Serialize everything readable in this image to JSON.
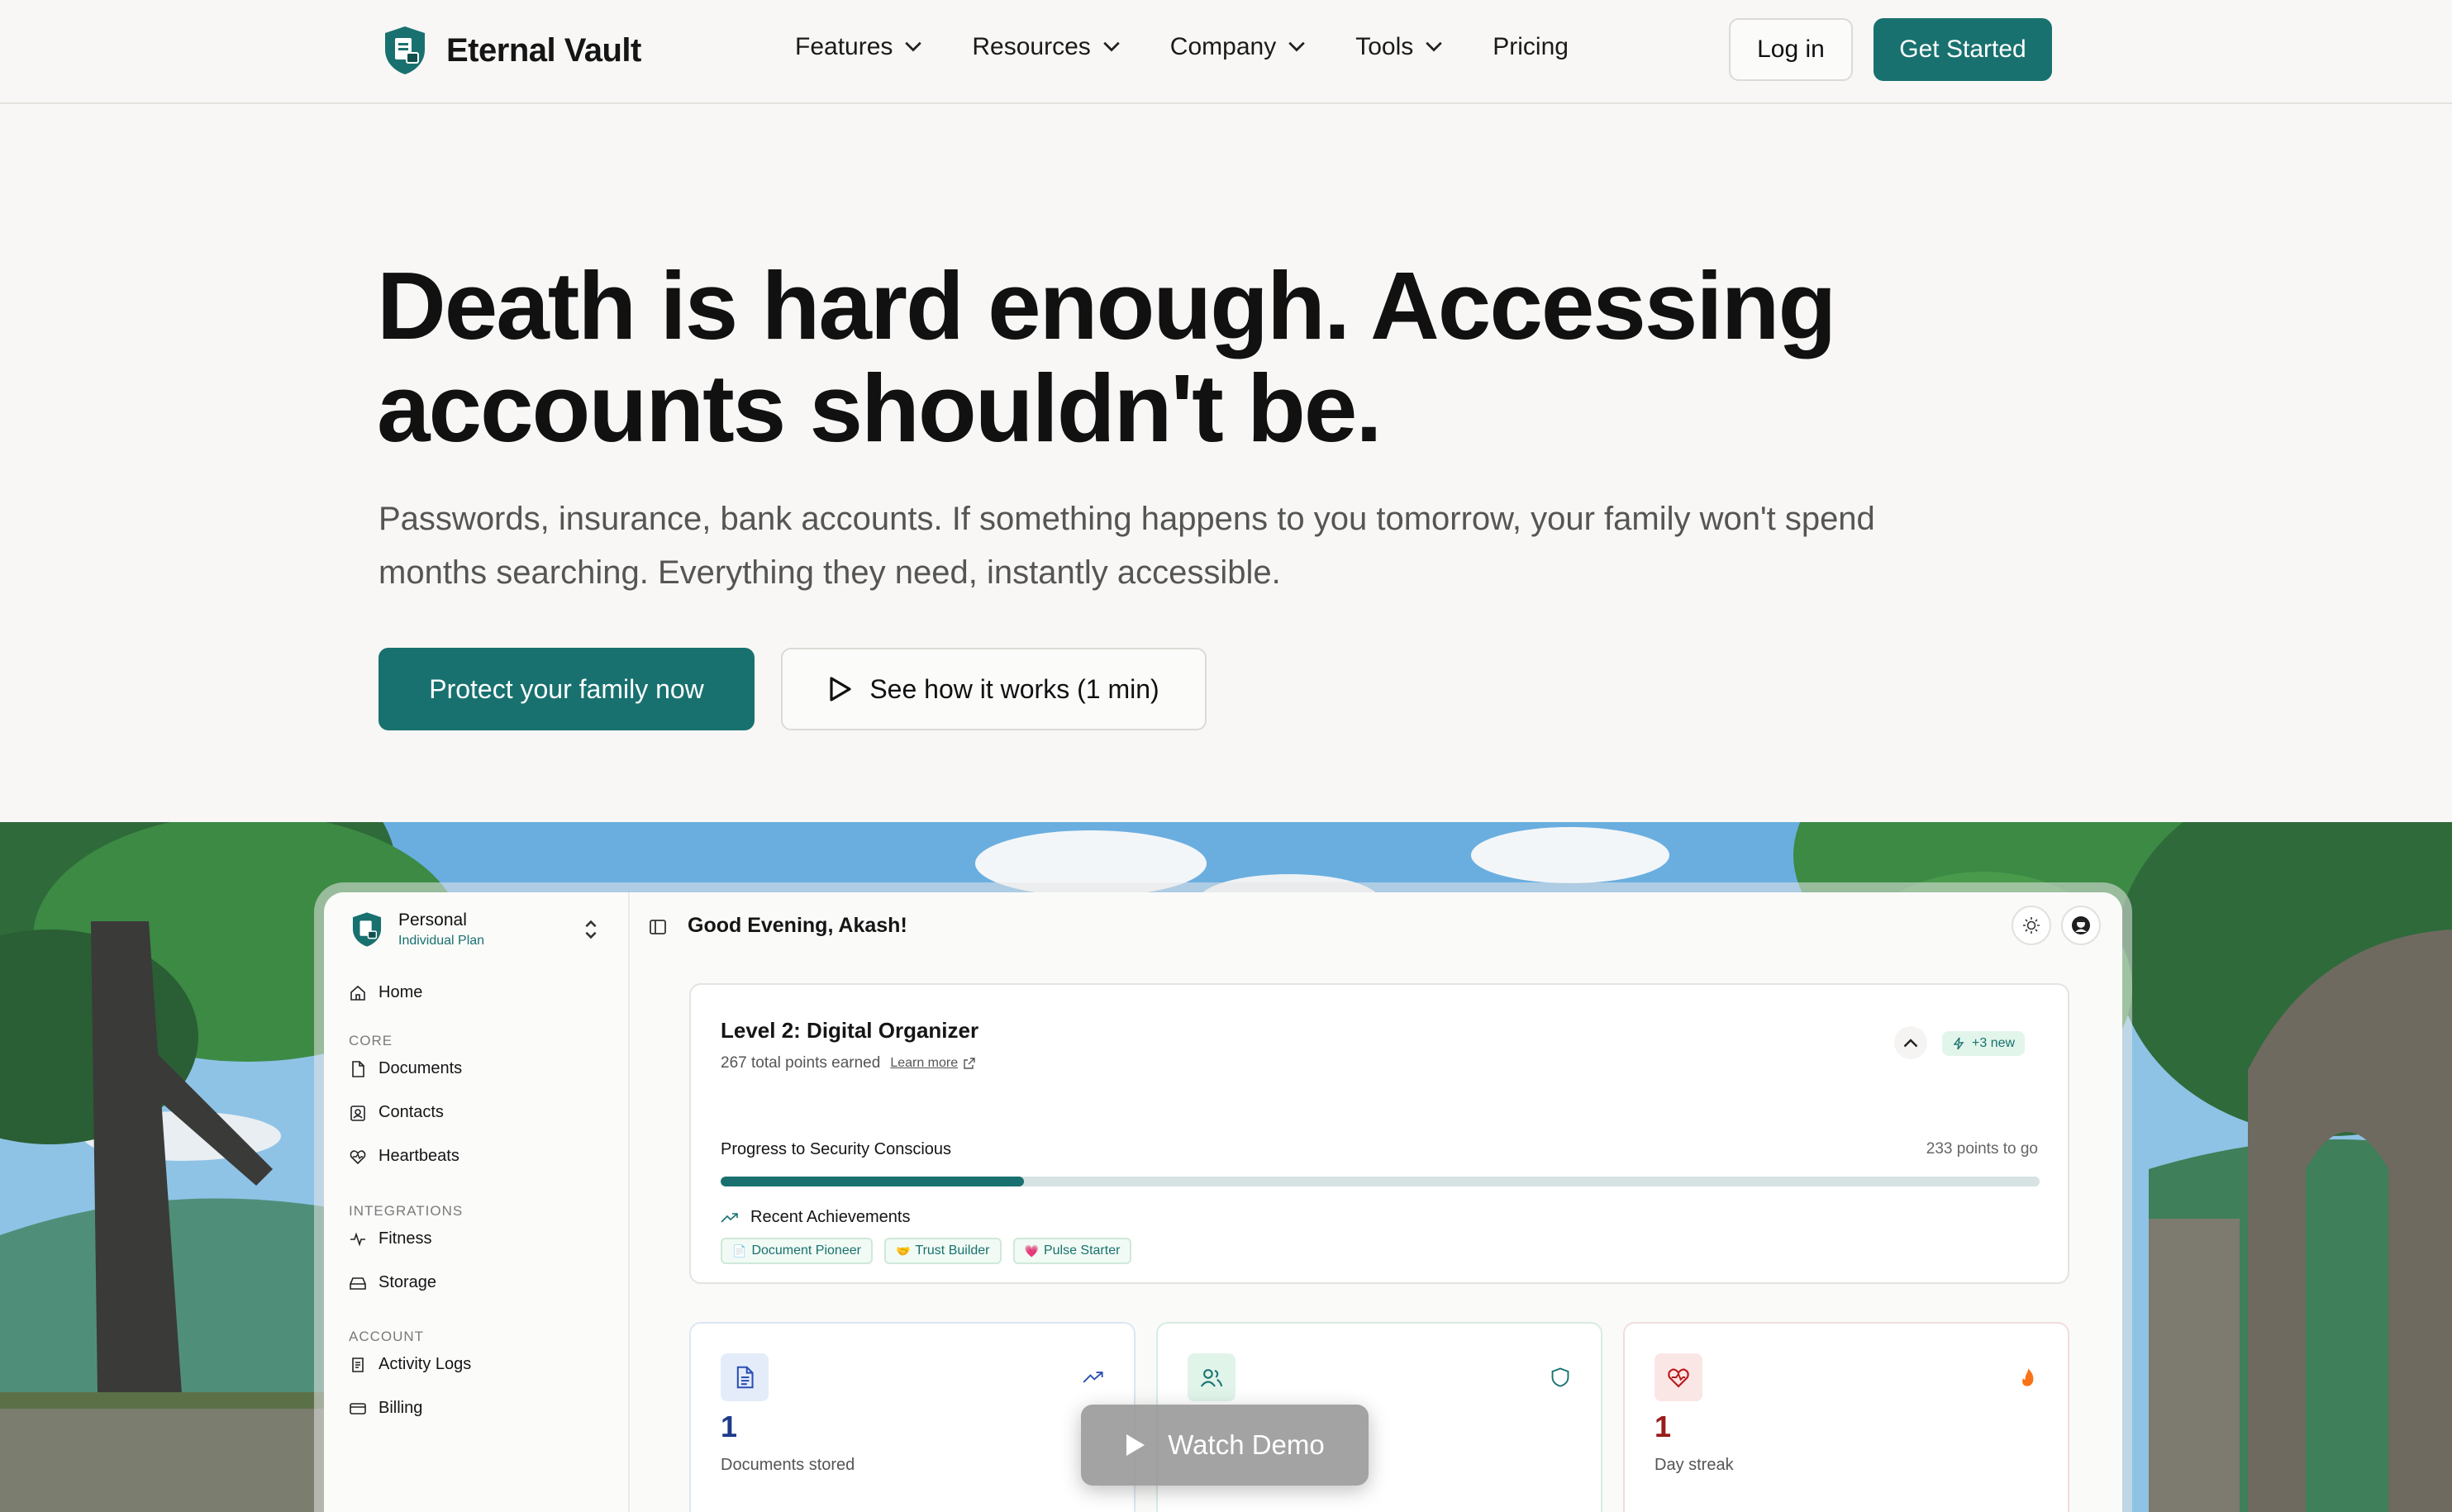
{
  "brand": {
    "name": "Eternal Vault",
    "accent": "#18716f"
  },
  "nav": {
    "items": [
      {
        "label": "Features",
        "has_dropdown": true
      },
      {
        "label": "Resources",
        "has_dropdown": true
      },
      {
        "label": "Company",
        "has_dropdown": true
      },
      {
        "label": "Tools",
        "has_dropdown": true
      },
      {
        "label": "Pricing",
        "has_dropdown": false
      }
    ],
    "login_label": "Log in",
    "get_started_label": "Get Started"
  },
  "hero": {
    "headline_line1": "Death is hard enough. Accessing",
    "headline_line2": "accounts shouldn't be.",
    "subtext": "Passwords, insurance, bank accounts. If something happens to you tomorrow, your family won't spend months searching. Everything they need, instantly accessible.",
    "primary_cta": "Protect your family now",
    "secondary_cta": "See how it works (1 min)"
  },
  "app": {
    "workspace": {
      "name": "Personal",
      "plan": "Individual Plan"
    },
    "sidebar": {
      "home_label": "Home",
      "sections": [
        {
          "title": "CORE",
          "items": [
            "Documents",
            "Contacts",
            "Heartbeats"
          ]
        },
        {
          "title": "INTEGRATIONS",
          "items": [
            "Fitness",
            "Storage"
          ]
        },
        {
          "title": "ACCOUNT",
          "items": [
            "Activity Logs",
            "Billing"
          ]
        }
      ]
    },
    "greeting": "Good Evening, Akash!",
    "level": {
      "title": "Level 2: Digital Organizer",
      "points": "267 total points earned",
      "learn_more": "Learn more",
      "badge": "+3 new",
      "progress_label": "Progress to Security Conscious",
      "remaining": "233 points to go",
      "progress_fraction": 0.23,
      "achievements_title": "Recent Achievements",
      "achievements": [
        {
          "icon": "📄",
          "label": "Document Pioneer"
        },
        {
          "icon": "🤝",
          "label": "Trust Builder"
        },
        {
          "icon": "💗",
          "label": "Pulse Starter"
        }
      ]
    },
    "stats": [
      {
        "value": "1",
        "label": "Documents stored",
        "icon": "document-icon",
        "trend": "trending-up-icon",
        "color": "#2a4fb3"
      },
      {
        "value": "",
        "label": "",
        "icon": "users-icon",
        "trend": "shield-icon",
        "color": "#18716f"
      },
      {
        "value": "1",
        "label": "Day streak",
        "icon": "heart-pulse-icon",
        "trend": "flame-icon",
        "color": "#9b1c1c"
      }
    ]
  },
  "watch_demo_label": "Watch Demo"
}
